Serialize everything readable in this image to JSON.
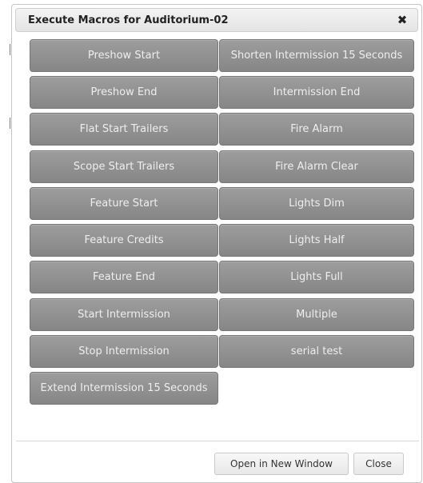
{
  "dialog": {
    "title": "Execute Macros for Auditorium-02",
    "close_glyph": "✖",
    "close_icon": "close-icon"
  },
  "macros": {
    "left": [
      "Preshow Start",
      "Preshow End",
      "Flat Start Trailers",
      "Scope Start Trailers",
      "Feature Start",
      "Feature Credits",
      "Feature End",
      "Start Intermission",
      "Stop Intermission",
      "Extend Intermission 15 Seconds"
    ],
    "right": [
      "Shorten Intermission 15 Seconds",
      "Intermission End",
      "Fire Alarm",
      "Fire Alarm Clear",
      "Lights Dim",
      "Lights Half",
      "Lights Full",
      "Multiple",
      "serial test"
    ]
  },
  "footer": {
    "open_new_window_label": "Open in New Window",
    "close_label": "Close"
  },
  "colors": {
    "macro_button": "#8f8f8f",
    "macro_text": "#eeeeee"
  }
}
